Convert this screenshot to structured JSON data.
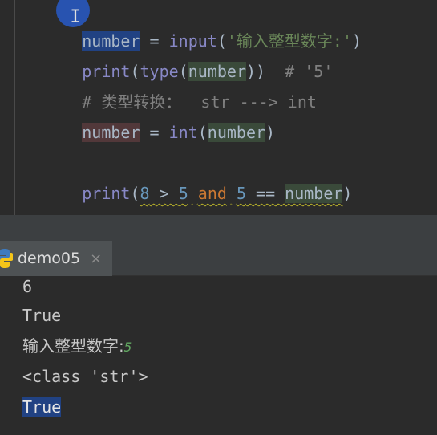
{
  "editor": {
    "lines": [
      {
        "var": "number",
        "eq": " = ",
        "fn": "input",
        "open": "(",
        "str": "'输入整型数字:'",
        "close": ")"
      },
      {
        "fn": "print",
        "open": "(",
        "fn2": "type",
        "open2": "(",
        "arg": "number",
        "close": "))",
        "comment": "  # '5'"
      },
      {
        "comment": "# 类型转换：  str ---> int"
      },
      {
        "var": "number",
        "eq": " = ",
        "fn": "int",
        "open": "(",
        "arg": "number",
        "close": ")"
      },
      {
        "fn": "print",
        "open": "(",
        "n1": "8",
        "op1": " > ",
        "n2": "5",
        "sp1": " ",
        "kw": "and",
        "sp2": " ",
        "n3": "5",
        "op2": " == ",
        "arg": "number",
        "close": ")"
      }
    ]
  },
  "run_panel": {
    "tab_label": "demo05",
    "close_glyph": "×",
    "output": [
      "6",
      "True",
      "输入整型数字:",
      "<class 'str'>",
      "True"
    ],
    "input_echo": "5"
  },
  "colors": {
    "editor_bg": "#2b2b2b",
    "panel_bg": "#3c3f41",
    "selection": "#214283",
    "string": "#6a8759",
    "keyword": "#cc7832",
    "number": "#6897bb",
    "comment": "#808080"
  },
  "icons": {
    "tab_icon": "python-icon",
    "cursor": "text-cursor-icon"
  }
}
